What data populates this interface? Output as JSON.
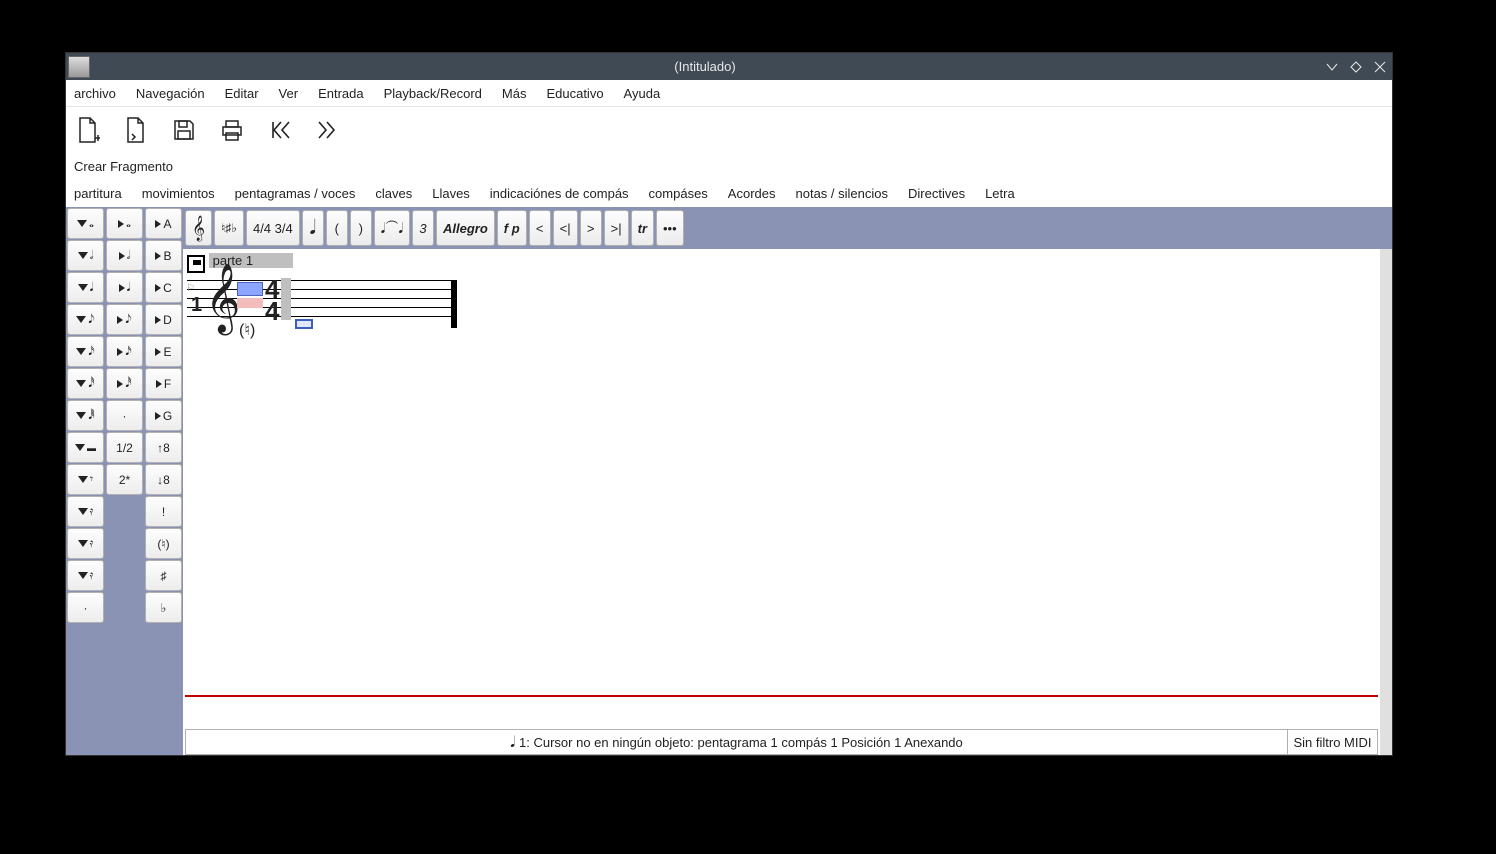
{
  "window": {
    "title": "(Intitulado)"
  },
  "menu": {
    "archivo": "archivo",
    "navegacion": "Navegación",
    "editar": "Editar",
    "ver": "Ver",
    "entrada": "Entrada",
    "playback": "Playback/Record",
    "mas": "Más",
    "educativo": "Educativo",
    "ayuda": "Ayuda"
  },
  "create_fragment": "Crear Fragmento",
  "tabs": {
    "partitura": "partitura",
    "movimientos": "movimientos",
    "pentagramas": "pentagramas / voces",
    "claves": "claves",
    "llaves": "Llaves",
    "indicaciones": "indicaciónes de compás",
    "compases": "compáses",
    "acordes": "Acordes",
    "notas": "notas / silencios",
    "directives": "Directives",
    "letra": "Letra"
  },
  "left": {
    "col1": [
      "𝅝",
      "𝅗𝅥",
      "𝅘𝅥",
      "𝅘𝅥𝅮",
      "𝅘𝅥𝅯",
      "𝅘𝅥𝅰",
      "𝅘𝅥𝅱",
      "▬",
      "𝄾",
      "𝄿",
      "𝄿",
      "𝄿",
      "·"
    ],
    "col2": [
      "𝅝",
      "𝅗𝅥",
      "𝅘𝅥",
      "𝅘𝅥𝅮",
      "𝅘𝅥𝅯",
      "𝅘𝅥𝅰",
      "·",
      "1/2",
      "2*"
    ],
    "col3": [
      "A",
      "B",
      "C",
      "D",
      "E",
      "F",
      "G",
      "↑8",
      "↓8",
      "!",
      "(♮)",
      "♯",
      "♭"
    ]
  },
  "topbar": {
    "time_sig_btn": "4/4 3/4",
    "paren_open": "(",
    "paren_close": ")",
    "triplet": "3",
    "allegro": "Allegro",
    "fp": "f p",
    "lt": "<",
    "ltbar": "<|",
    "gt": ">",
    "gtbar": ">|",
    "tr": "tr",
    "more": "•••"
  },
  "score": {
    "part_label": "parte 1",
    "staff_number": "1",
    "ts_top": "4",
    "ts_bot": "4",
    "natural_mark": "(♮)"
  },
  "status": {
    "main": "1: Cursor no en ningún objeto: pentagrama 1 compás 1 Posición 1 Anexando",
    "right": "Sin filtro MIDI"
  }
}
